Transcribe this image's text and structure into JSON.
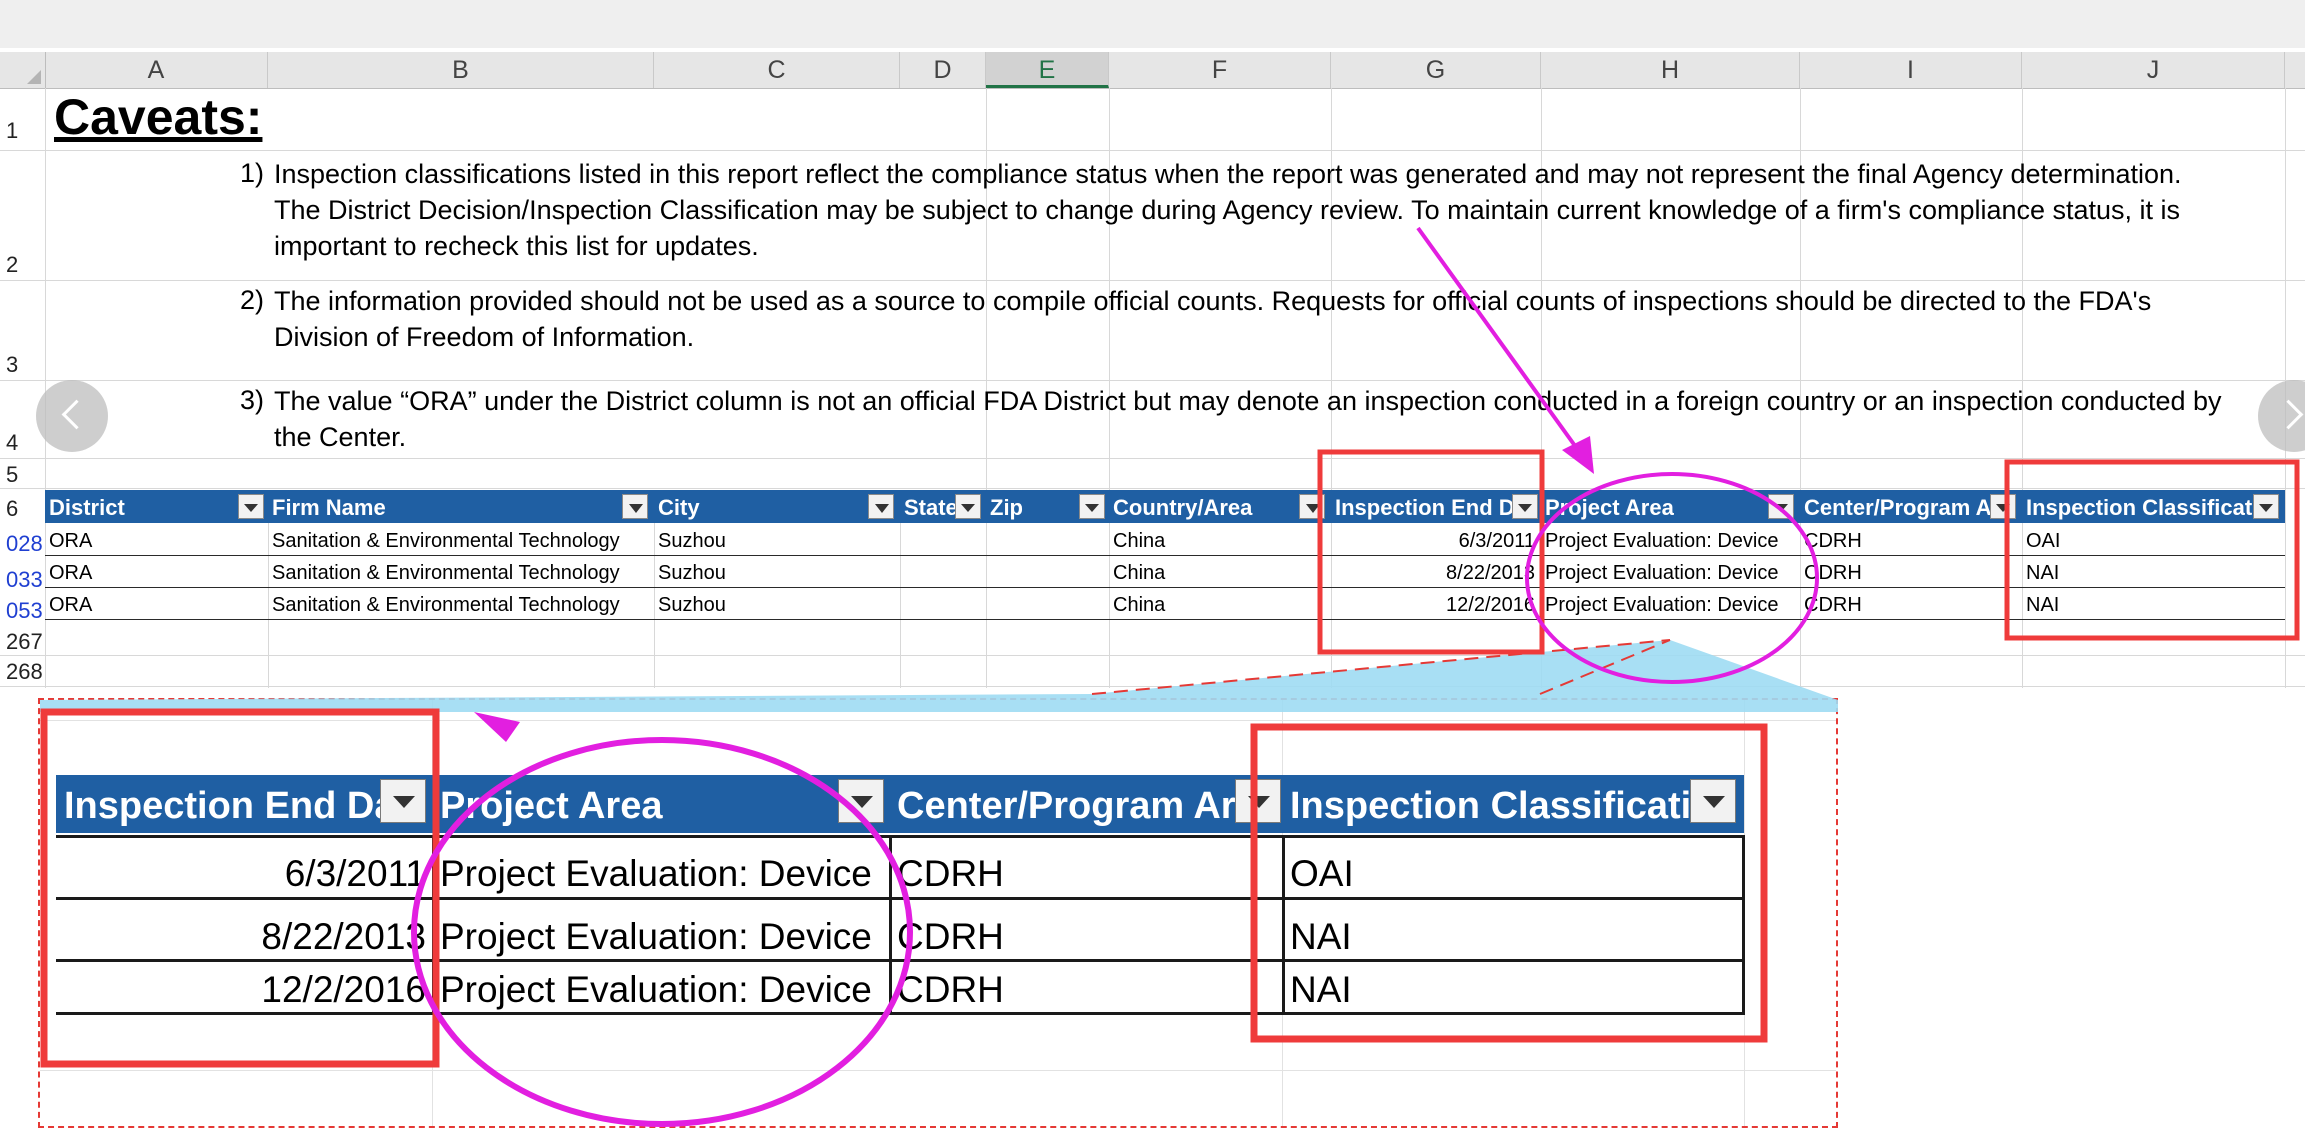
{
  "columns": [
    "A",
    "B",
    "C",
    "D",
    "E",
    "F",
    "G",
    "H",
    "I",
    "J"
  ],
  "active_column": "E",
  "rows": {
    "top": [
      "1",
      "2",
      "3",
      "4",
      "5",
      "6"
    ],
    "data": [
      "028",
      "033",
      "053"
    ],
    "bottom": [
      "267",
      "268"
    ]
  },
  "caveats": {
    "title": "Caveats:",
    "items": [
      {
        "num": "1)",
        "lines": [
          "Inspection classifications listed in this report reflect the compliance status when the report was generated and may not represent the final Agency determination.",
          "The District Decision/Inspection Classification may be subject to change during Agency review. To maintain current knowledge of a firm's compliance status, it is",
          "important to recheck this list for updates."
        ]
      },
      {
        "num": "2)",
        "lines": [
          "The information provided should not be used as a source to compile official counts.  Requests for official counts of inspections should be directed to the FDA's",
          "Division of Freedom of Information."
        ]
      },
      {
        "num": "3)",
        "lines": [
          "The value “ORA” under the District column is not an official FDA District but may denote an inspection conducted in a foreign country or an inspection conducted by",
          "the Center."
        ]
      }
    ]
  },
  "table": {
    "headers": [
      "District",
      "Firm Name",
      "City",
      "State",
      "Zip",
      "Country/Area",
      "Inspection End Da",
      "Project Area",
      "Center/Program Ar",
      "Inspection Classificati"
    ],
    "rows": [
      [
        "ORA",
        "Sanitation & Environmental Technology",
        "Suzhou",
        "",
        "",
        "China",
        "6/3/2011",
        "Project Evaluation: Device",
        "CDRH",
        "OAI"
      ],
      [
        "ORA",
        "Sanitation & Environmental Technology",
        "Suzhou",
        "",
        "",
        "China",
        "8/22/2013",
        "Project Evaluation: Device",
        "CDRH",
        "NAI"
      ],
      [
        "ORA",
        "Sanitation & Environmental Technology",
        "Suzhou",
        "",
        "",
        "China",
        "12/2/2016",
        "Project Evaluation: Device",
        "CDRH",
        "NAI"
      ]
    ]
  },
  "zoom": {
    "headers": [
      "Inspection End Da",
      "Project Area",
      "Center/Program Ar",
      "Inspection Classificati"
    ],
    "rows": [
      [
        "6/3/2011",
        "Project Evaluation: Device",
        "CDRH",
        "OAI"
      ],
      [
        "8/22/2013",
        "Project Evaluation: Device",
        "CDRH",
        "NAI"
      ],
      [
        "12/2/2016",
        "Project Evaluation: Device",
        "CDRH",
        "NAI"
      ]
    ]
  },
  "icons": {
    "prev": "chevron-left-icon",
    "next": "chevron-right-icon",
    "filter": "filter-dropdown-icon"
  },
  "colors": {
    "header_bg": "#1f5fa3",
    "highlight_box": "#ef3b3b",
    "highlight_circle": "#e21fe0",
    "arrow": "#e21fe0",
    "zoom_border": "#e53935"
  }
}
